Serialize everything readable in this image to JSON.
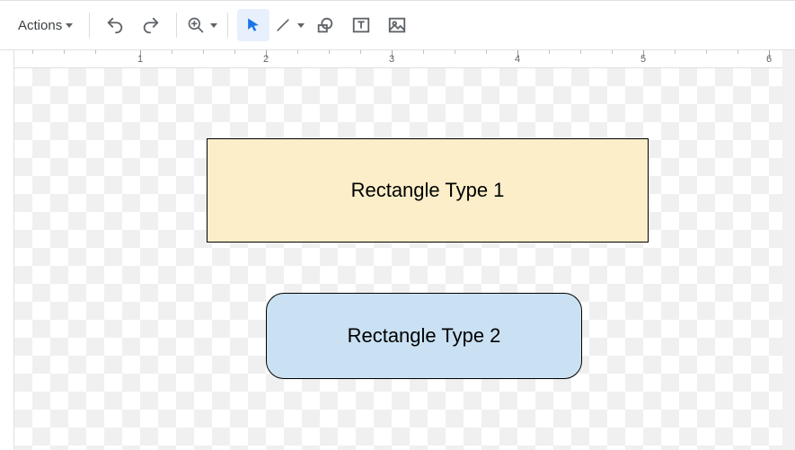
{
  "toolbar": {
    "actions_label": "Actions",
    "icons": {
      "undo": "undo-icon",
      "redo": "redo-icon",
      "zoom": "zoom-icon",
      "select": "select-icon",
      "line": "line-icon",
      "shape": "shape-icon",
      "text": "text-box-icon",
      "image": "image-icon"
    }
  },
  "ruler": {
    "majors": [
      1,
      2,
      3,
      4,
      5,
      6
    ]
  },
  "shapes": {
    "rect1": {
      "label": "Rectangle Type 1",
      "fill": "#fceec9"
    },
    "rect2": {
      "label": "Rectangle Type 2",
      "fill": "#c9e1f2"
    }
  },
  "chart_data": {
    "type": "diagram",
    "title": "",
    "nodes": [
      {
        "id": "rect1",
        "label": "Rectangle Type 1",
        "shape": "rectangle",
        "fill": "#fceec9",
        "stroke": "#000000",
        "rounded": false
      },
      {
        "id": "rect2",
        "label": "Rectangle Type 2",
        "shape": "rectangle",
        "fill": "#c9e1f2",
        "stroke": "#000000",
        "rounded": true
      }
    ],
    "edges": []
  }
}
